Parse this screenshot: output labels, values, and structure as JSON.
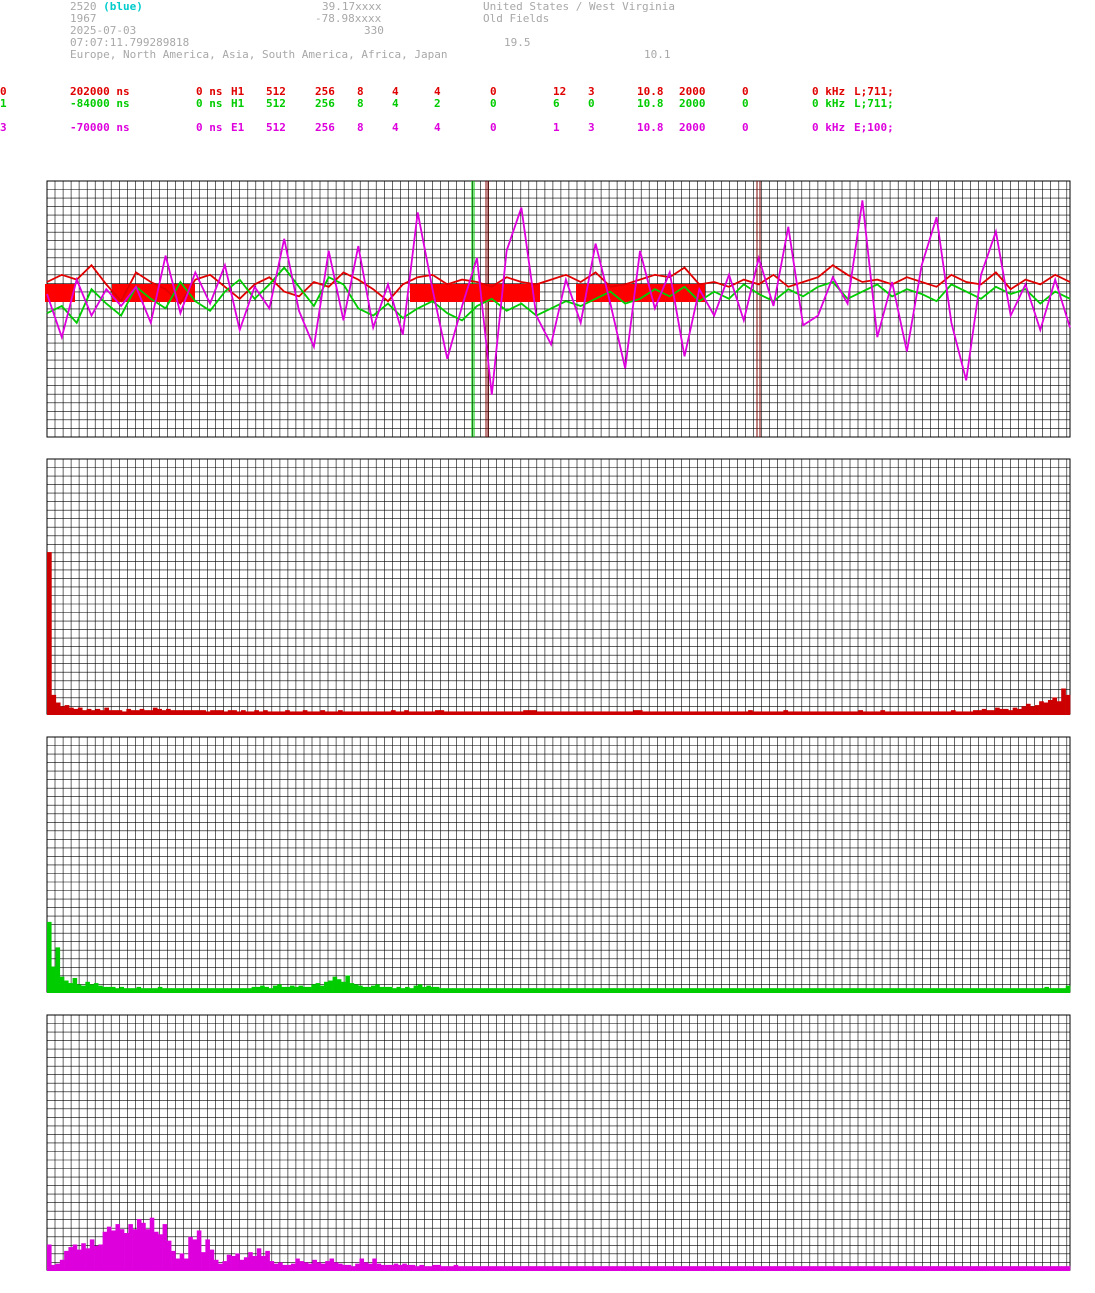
{
  "header": {
    "station_id": "2520",
    "station_color": "(blue)",
    "lat": "39.17xxxx",
    "country": "United States / West Virginia",
    "year": "1967",
    "lon": "-78.98xxxx",
    "city": "Old Fields",
    "date": "2025-07-03",
    "alt": "330",
    "time": "07:07:11.799289818",
    "val1": "19.5",
    "regions": "Europe, North America, Asia, South America, Africa, Japan",
    "val2": "10.1"
  },
  "channels": [
    {
      "ch": "0",
      "offset": "202000 ns",
      "delay": "0 ns",
      "ant": "H1",
      "c1": "512",
      "c2": "256",
      "c3": "8",
      "c4": "4",
      "c5": "4",
      "c6": "0",
      "c7": "12",
      "c8": "3",
      "c9": "10.8",
      "c10": "2000",
      "c11": "0",
      "c12": "0 kHz",
      "c13": "L;711;",
      "color": "#e00000"
    },
    {
      "ch": "1",
      "offset": "-84000 ns",
      "delay": "0 ns",
      "ant": "H1",
      "c1": "512",
      "c2": "256",
      "c3": "8",
      "c4": "4",
      "c5": "2",
      "c6": "0",
      "c7": "6",
      "c8": "0",
      "c9": "10.8",
      "c10": "2000",
      "c11": "0",
      "c12": "0 kHz",
      "c13": "L;711;",
      "color": "#00cc00"
    },
    {
      "ch": "3",
      "offset": "-70000 ns",
      "delay": "0 ns",
      "ant": "E1",
      "c1": "512",
      "c2": "256",
      "c3": "8",
      "c4": "4",
      "c5": "4",
      "c6": "0",
      "c7": "1",
      "c8": "3",
      "c9": "10.8",
      "c10": "2000",
      "c11": "0",
      "c12": "0 kHz",
      "c13": "E;100;",
      "color": "#dd00dd"
    }
  ],
  "chart_data": [
    {
      "type": "line",
      "series": [
        {
          "color": "#e00000",
          "values": [
            0.5,
            0.8,
            0.6,
            1.2,
            0.4,
            -0.3,
            0.9,
            0.5,
            0.2,
            -0.4,
            0.6,
            0.8,
            0.3,
            -0.2,
            0.4,
            0.7,
            0.1,
            -0.1,
            0.5,
            0.3,
            0.9,
            0.6,
            0.2,
            -0.3,
            0.4,
            0.7,
            0.8,
            0.4,
            0.6,
            0.5,
            0.3,
            0.7,
            0.5,
            0.4,
            0.6,
            0.8,
            0.5,
            0.9,
            0.3,
            0.4,
            0.6,
            0.8,
            0.7,
            1.1,
            0.4,
            0.5,
            0.3,
            0.6,
            0.4,
            0.8,
            0.3,
            0.5,
            0.7,
            1.2,
            0.8,
            0.5,
            0.6,
            0.4,
            0.7,
            0.5,
            0.3,
            0.8,
            0.5,
            0.4,
            0.9,
            0.2,
            0.6,
            0.4,
            0.8,
            0.5
          ]
        },
        {
          "color": "#00cc00",
          "values": [
            -0.8,
            -0.5,
            -1.2,
            0.2,
            -0.4,
            -0.9,
            0.3,
            -0.2,
            -0.6,
            0.5,
            -0.3,
            -0.7,
            0.1,
            0.6,
            -0.2,
            0.4,
            1.1,
            0.3,
            -0.5,
            0.7,
            0.4,
            -0.6,
            -0.9,
            -0.4,
            -1.0,
            -0.6,
            -0.3,
            -0.8,
            -1.1,
            -0.5,
            -0.2,
            -0.7,
            -0.4,
            -0.9,
            -0.6,
            -0.3,
            -0.5,
            -0.2,
            0.1,
            -0.4,
            -0.2,
            0.2,
            -0.1,
            0.3,
            -0.3,
            0.1,
            -0.2,
            0.4,
            0.0,
            -0.3,
            0.2,
            -0.1,
            0.3,
            0.5,
            -0.2,
            0.1,
            0.4,
            -0.1,
            0.2,
            0.0,
            -0.3,
            0.4,
            0.1,
            -0.2,
            0.3,
            0.0,
            0.2,
            -0.4,
            0.1,
            -0.2
          ]
        },
        {
          "color": "#dd00dd",
          "values": [
            0,
            -1.8,
            0.6,
            -0.9,
            0.2,
            -0.5,
            0.3,
            -1.2,
            1.6,
            -0.8,
            0.9,
            -0.4,
            1.2,
            -1.5,
            0.3,
            -0.6,
            2.3,
            -0.7,
            -2.2,
            1.8,
            -1.1,
            2.0,
            -1.4,
            0.4,
            -1.7,
            3.4,
            0.2,
            -2.7,
            -0.5,
            1.5,
            -4.2,
            1.8,
            3.6,
            -0.9,
            -2.1,
            0.6,
            -1.2,
            2.1,
            -0.4,
            -3.1,
            1.8,
            -0.6,
            0.9,
            -2.6,
            0.2,
            -0.9,
            0.8,
            -1.1,
            1.5,
            -0.5,
            2.8,
            -1.3,
            -0.9,
            0.7,
            -0.4,
            3.9,
            -1.8,
            0.5,
            -2.4,
            1.2,
            3.2,
            -1.2,
            -3.6,
            0.8,
            2.6,
            -0.9,
            0.4,
            -1.5,
            0.6,
            -1.4
          ]
        }
      ]
    },
    {
      "type": "bar",
      "color": "#cc0000",
      "values": [
        12.7,
        1.5,
        0.9,
        0.6,
        0.7,
        0.5,
        0.4,
        0.5,
        0.3,
        0.4,
        0.3,
        0.4,
        0.3,
        0.5,
        0.3,
        0.3,
        0.3,
        0.2,
        0.4,
        0.3,
        0.3,
        0.4,
        0.3,
        0.3,
        0.5,
        0.4,
        0.3,
        0.4,
        0.3,
        0.3,
        0.3,
        0.3,
        0.3,
        0.3,
        0.3,
        0.3,
        0.2,
        0.3,
        0.3,
        0.3,
        0.2,
        0.3,
        0.3,
        0.2,
        0.3,
        0.2,
        0.2,
        0.3,
        0.2,
        0.3,
        0.2,
        0.2,
        0.2,
        0.2,
        0.3,
        0.2,
        0.2,
        0.2,
        0.3,
        0.2,
        0.2,
        0.2,
        0.3,
        0.2,
        0.2,
        0.2,
        0.3,
        0.2,
        0.2,
        0.2,
        0.2,
        0.2,
        0.2,
        0.2,
        0.2,
        0.2,
        0.2,
        0.2,
        0.3,
        0.2,
        0.2,
        0.3,
        0.2,
        0.2,
        0.2,
        0.2,
        0.2,
        0.2,
        0.3,
        0.3,
        0.2,
        0.2,
        0.2,
        0.2,
        0.2,
        0.2,
        0.2,
        0.2,
        0.2,
        0.2,
        0.2,
        0.2,
        0.2,
        0.2,
        0.2,
        0.2,
        0.2,
        0.2,
        0.3,
        0.3,
        0.3,
        0.2,
        0.2,
        0.2,
        0.2,
        0.2,
        0.2,
        0.2,
        0.2,
        0.2,
        0.2,
        0.2,
        0.2,
        0.2,
        0.2,
        0.2,
        0.2,
        0.2,
        0.2,
        0.2,
        0.2,
        0.2,
        0.2,
        0.3,
        0.3,
        0.2,
        0.2,
        0.2,
        0.2,
        0.2,
        0.2,
        0.2,
        0.2,
        0.2,
        0.2,
        0.2,
        0.2,
        0.2,
        0.2,
        0.2,
        0.2,
        0.2,
        0.2,
        0.2,
        0.2,
        0.2,
        0.2,
        0.2,
        0.2,
        0.3,
        0.2,
        0.2,
        0.2,
        0.2,
        0.2,
        0.2,
        0.2,
        0.3,
        0.2,
        0.2,
        0.2,
        0.2,
        0.2,
        0.2,
        0.2,
        0.2,
        0.2,
        0.2,
        0.2,
        0.2,
        0.2,
        0.2,
        0.2,
        0.2,
        0.3,
        0.2,
        0.2,
        0.2,
        0.2,
        0.3,
        0.2,
        0.2,
        0.2,
        0.2,
        0.2,
        0.2,
        0.2,
        0.2,
        0.2,
        0.2,
        0.2,
        0.2,
        0.2,
        0.2,
        0.2,
        0.3,
        0.2,
        0.2,
        0.2,
        0.2,
        0.3,
        0.3,
        0.4,
        0.3,
        0.3,
        0.5,
        0.4,
        0.4,
        0.3,
        0.5,
        0.4,
        0.6,
        0.8,
        0.6,
        0.7,
        1.0,
        0.9,
        1.1,
        1.3,
        1.0,
        2.0,
        1.5
      ]
    },
    {
      "type": "bar",
      "color": "#00cc00",
      "values": [
        5.5,
        2.0,
        3.5,
        1.2,
        0.9,
        0.7,
        1.1,
        0.6,
        0.5,
        0.8,
        0.6,
        0.7,
        0.5,
        0.4,
        0.4,
        0.4,
        0.3,
        0.4,
        0.3,
        0.3,
        0.3,
        0.4,
        0.3,
        0.3,
        0.3,
        0.3,
        0.4,
        0.3,
        0.3,
        0.3,
        0.3,
        0.3,
        0.3,
        0.3,
        0.3,
        0.3,
        0.3,
        0.3,
        0.3,
        0.3,
        0.3,
        0.3,
        0.3,
        0.3,
        0.3,
        0.3,
        0.3,
        0.3,
        0.4,
        0.4,
        0.5,
        0.4,
        0.3,
        0.5,
        0.6,
        0.4,
        0.4,
        0.5,
        0.4,
        0.5,
        0.4,
        0.4,
        0.6,
        0.7,
        0.5,
        0.8,
        0.9,
        1.2,
        1.0,
        0.8,
        1.3,
        0.7,
        0.6,
        0.5,
        0.4,
        0.4,
        0.5,
        0.6,
        0.4,
        0.4,
        0.4,
        0.3,
        0.4,
        0.3,
        0.4,
        0.3,
        0.5,
        0.6,
        0.4,
        0.5,
        0.4,
        0.4,
        0.3,
        0.3,
        0.3,
        0.3,
        0.3,
        0.3,
        0.3,
        0.3,
        0.3,
        0.3,
        0.3,
        0.3,
        0.3,
        0.3,
        0.3,
        0.3,
        0.3,
        0.3,
        0.3,
        0.3,
        0.3,
        0.3,
        0.3,
        0.3,
        0.3,
        0.3,
        0.3,
        0.3,
        0.3,
        0.3,
        0.3,
        0.3,
        0.3,
        0.3,
        0.3,
        0.3,
        0.3,
        0.3,
        0.3,
        0.3,
        0.3,
        0.3,
        0.3,
        0.3,
        0.3,
        0.3,
        0.3,
        0.3,
        0.3,
        0.3,
        0.3,
        0.3,
        0.3,
        0.3,
        0.3,
        0.3,
        0.3,
        0.3,
        0.3,
        0.3,
        0.3,
        0.3,
        0.3,
        0.3,
        0.3,
        0.3,
        0.3,
        0.3,
        0.3,
        0.3,
        0.3,
        0.3,
        0.3,
        0.3,
        0.3,
        0.3,
        0.3,
        0.3,
        0.3,
        0.3,
        0.3,
        0.3,
        0.3,
        0.3,
        0.3,
        0.3,
        0.3,
        0.3,
        0.3,
        0.3,
        0.3,
        0.3,
        0.3,
        0.3,
        0.3,
        0.3,
        0.3,
        0.3,
        0.3,
        0.3,
        0.3,
        0.3,
        0.3,
        0.3,
        0.3,
        0.3,
        0.3,
        0.3,
        0.3,
        0.3,
        0.3,
        0.3,
        0.3,
        0.3,
        0.3,
        0.3,
        0.3,
        0.3,
        0.3,
        0.3,
        0.3,
        0.3,
        0.3,
        0.3,
        0.3,
        0.3,
        0.3,
        0.3,
        0.3,
        0.3,
        0.3,
        0.3,
        0.3,
        0.3,
        0.3,
        0.3,
        0.3,
        0.3,
        0.3,
        0.3,
        0.3,
        0.3,
        0.4,
        0.3,
        0.3,
        0.3,
        0.3,
        0.5
      ]
    },
    {
      "type": "bar",
      "color": "#dd00dd",
      "values": [
        2.0,
        0.4,
        0.5,
        0.8,
        1.5,
        1.8,
        2.0,
        1.6,
        2.1,
        1.7,
        2.4,
        1.9,
        2.0,
        3.0,
        3.4,
        3.1,
        3.6,
        3.2,
        2.9,
        3.6,
        3.2,
        4.0,
        3.7,
        3.2,
        4.1,
        3.0,
        2.8,
        3.6,
        2.3,
        1.5,
        0.9,
        1.3,
        0.9,
        2.6,
        2.4,
        3.1,
        1.4,
        2.4,
        1.6,
        0.8,
        0.5,
        0.7,
        1.2,
        1.1,
        1.3,
        0.8,
        1.0,
        1.4,
        1.1,
        1.7,
        1.1,
        1.5,
        0.7,
        0.5,
        0.6,
        0.4,
        0.4,
        0.5,
        0.9,
        0.7,
        0.6,
        0.5,
        0.8,
        0.6,
        0.5,
        0.7,
        0.9,
        0.6,
        0.5,
        0.4,
        0.4,
        0.3,
        0.5,
        0.9,
        0.6,
        0.5,
        0.9,
        0.5,
        0.4,
        0.4,
        0.4,
        0.5,
        0.4,
        0.5,
        0.4,
        0.4,
        0.3,
        0.4,
        0.3,
        0.3,
        0.4,
        0.4,
        0.3,
        0.3,
        0.3,
        0.4,
        0.3,
        0.3,
        0.3,
        0.3,
        0.3,
        0.3,
        0.3,
        0.3,
        0.3,
        0.3,
        0.3,
        0.3,
        0.3,
        0.3,
        0.3,
        0.3,
        0.3,
        0.3,
        0.3,
        0.3,
        0.3,
        0.3,
        0.3,
        0.3,
        0.3,
        0.3,
        0.3,
        0.3,
        0.3,
        0.3,
        0.3,
        0.3,
        0.3,
        0.3,
        0.3,
        0.3,
        0.3,
        0.3,
        0.3,
        0.3,
        0.3,
        0.3,
        0.3,
        0.3,
        0.3,
        0.3,
        0.3,
        0.3,
        0.3,
        0.3,
        0.3,
        0.3,
        0.3,
        0.3,
        0.3,
        0.3,
        0.3,
        0.3,
        0.3,
        0.3,
        0.3,
        0.3,
        0.3,
        0.3,
        0.3,
        0.3,
        0.3,
        0.3,
        0.3,
        0.3,
        0.3,
        0.3,
        0.3,
        0.3,
        0.3,
        0.3,
        0.3,
        0.3,
        0.3,
        0.3,
        0.3,
        0.3,
        0.3,
        0.3,
        0.3,
        0.3,
        0.3,
        0.3,
        0.3,
        0.3,
        0.3,
        0.3,
        0.3,
        0.3,
        0.3,
        0.3,
        0.3,
        0.3,
        0.3,
        0.3,
        0.3,
        0.3,
        0.3,
        0.3,
        0.3,
        0.3,
        0.3,
        0.3,
        0.3,
        0.3,
        0.3,
        0.3,
        0.3,
        0.3,
        0.3,
        0.3,
        0.3,
        0.3,
        0.3,
        0.3,
        0.3,
        0.3,
        0.3,
        0.3,
        0.3,
        0.3,
        0.3,
        0.3,
        0.3,
        0.3,
        0.3,
        0.3,
        0.3,
        0.3,
        0.3,
        0.3,
        0.3,
        0.3,
        0.3,
        0.3,
        0.3,
        0.3,
        0.3
      ]
    }
  ]
}
